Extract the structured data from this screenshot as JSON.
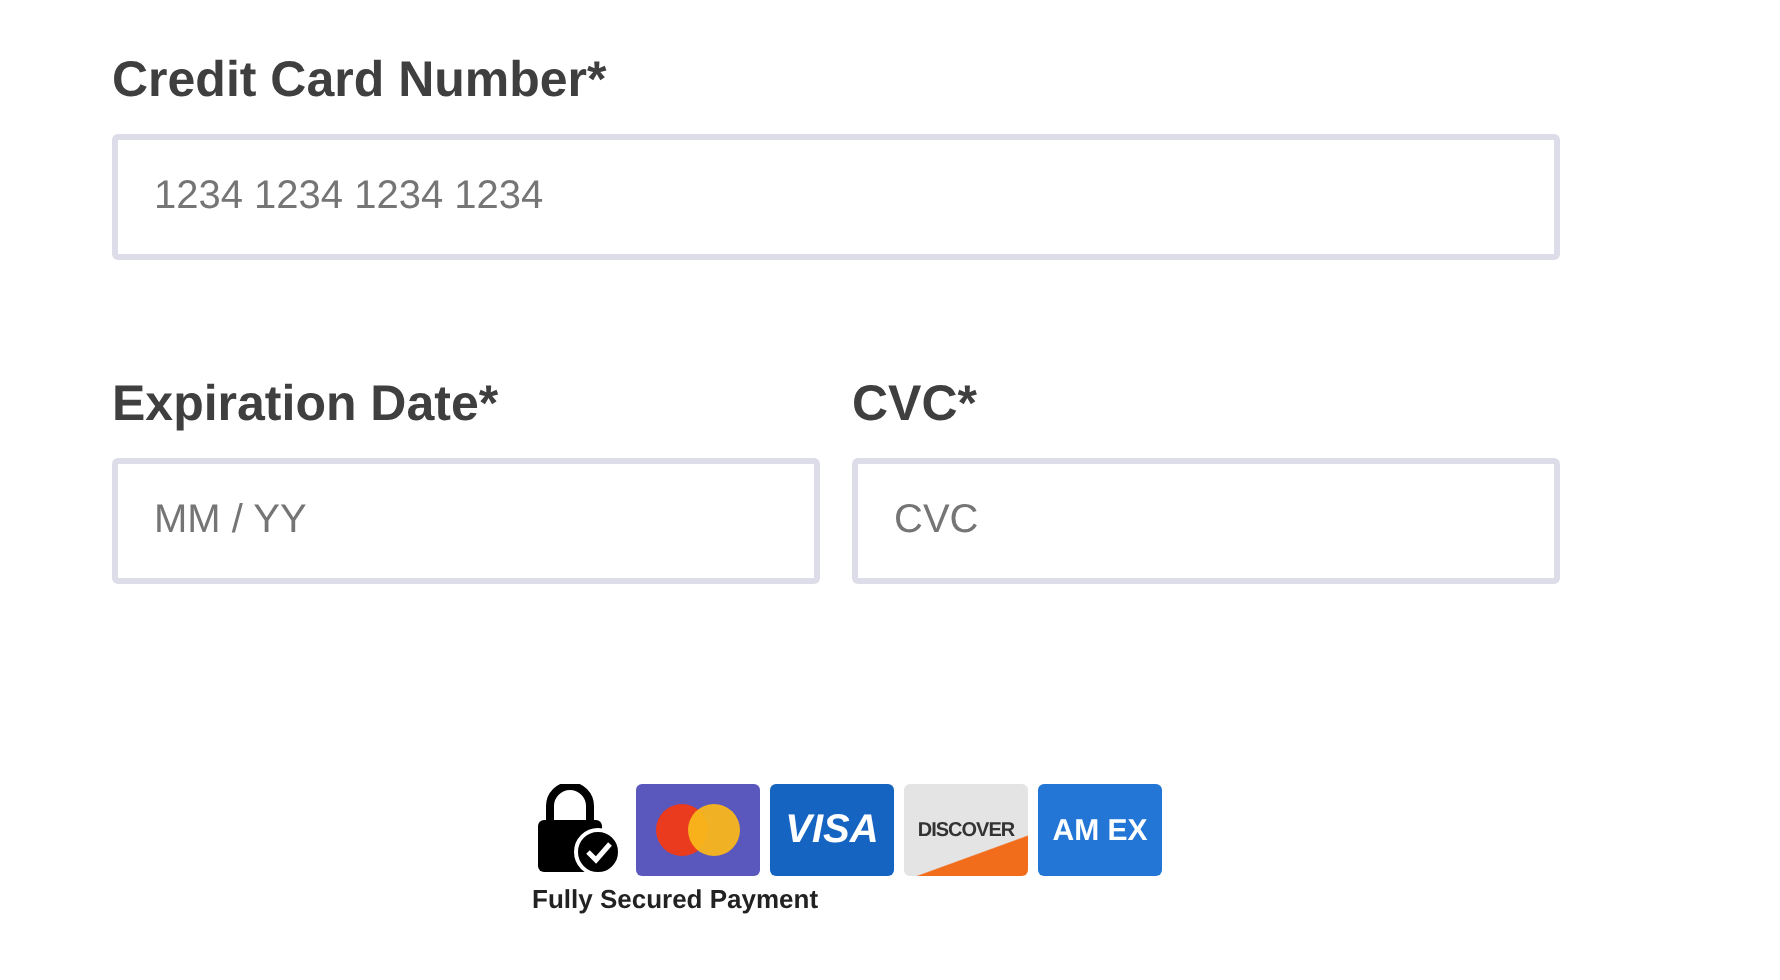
{
  "fields": [
    {
      "label": "Credit Card Number*",
      "placeholder": "1234 1234 1234 1234",
      "kind": "wide"
    },
    {
      "label": "Expiration Date*",
      "placeholder": "MM / YY",
      "kind": "half"
    },
    {
      "label": "CVC*",
      "placeholder": "CVC",
      "kind": "half"
    }
  ],
  "payment_badges": [
    {
      "kind": "lock"
    },
    {
      "kind": "mastercard"
    },
    {
      "kind": "visa",
      "text": "VISA"
    },
    {
      "kind": "discover",
      "text": "DISCOVER"
    },
    {
      "kind": "amex",
      "text": "AM EX"
    }
  ],
  "caption": "Fully Secured Payment"
}
